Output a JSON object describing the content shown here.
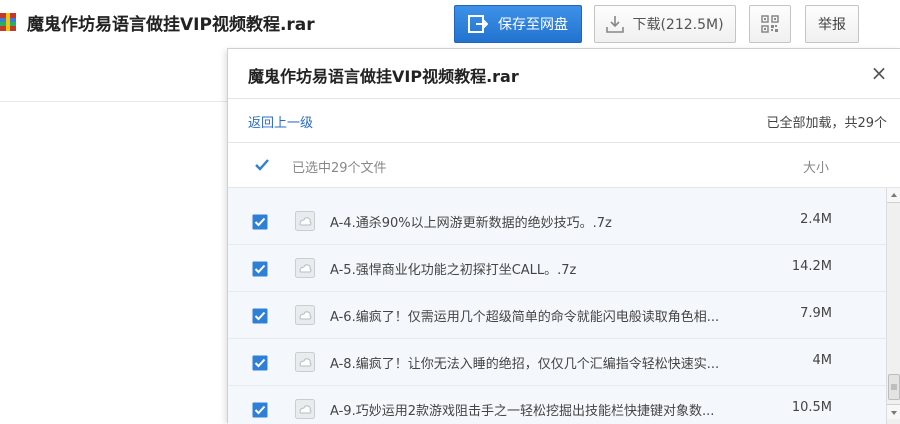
{
  "page": {
    "title": "魔鬼作坊易语言做挂VIP视频教程.rar",
    "file_icon": "archive-file-icon"
  },
  "toolbar": {
    "save_label": "保存至网盘",
    "download_label": "下载(212.5M)",
    "qr_icon": "qr-code-icon",
    "report_label": "举报"
  },
  "panel": {
    "title": "魔鬼作坊易语言做挂VIP视频教程.rar",
    "close_label": "×",
    "back_link": "返回上一级",
    "load_status": "已全部加载，共29个",
    "selected_count": "已选中29个文件",
    "size_header": "大小"
  },
  "files": [
    {
      "name": "A-4.通杀90%以上网游更新数据的绝妙技巧。.7z",
      "size": "2.4M",
      "checked": true
    },
    {
      "name": "A-5.强悍商业化功能之初探打坐CALL。.7z",
      "size": "14.2M",
      "checked": true
    },
    {
      "name": "A-6.编疯了！仅需运用几个超级简单的命令就能闪电般读取角色相...",
      "size": "7.9M",
      "checked": true
    },
    {
      "name": "A-8.编疯了！让你无法入睡的绝招，仅仅几个汇编指令轻松快速实...",
      "size": "4M",
      "checked": true
    },
    {
      "name": "A-9.巧妙运用2款游戏阻击手之一轻松挖掘出技能栏快捷键对象数...",
      "size": "10.5M",
      "checked": true
    }
  ],
  "colors": {
    "accent": "#2a7bd8",
    "checkbox": "#2f7fd6",
    "row_bg": "#f4f8fc"
  }
}
